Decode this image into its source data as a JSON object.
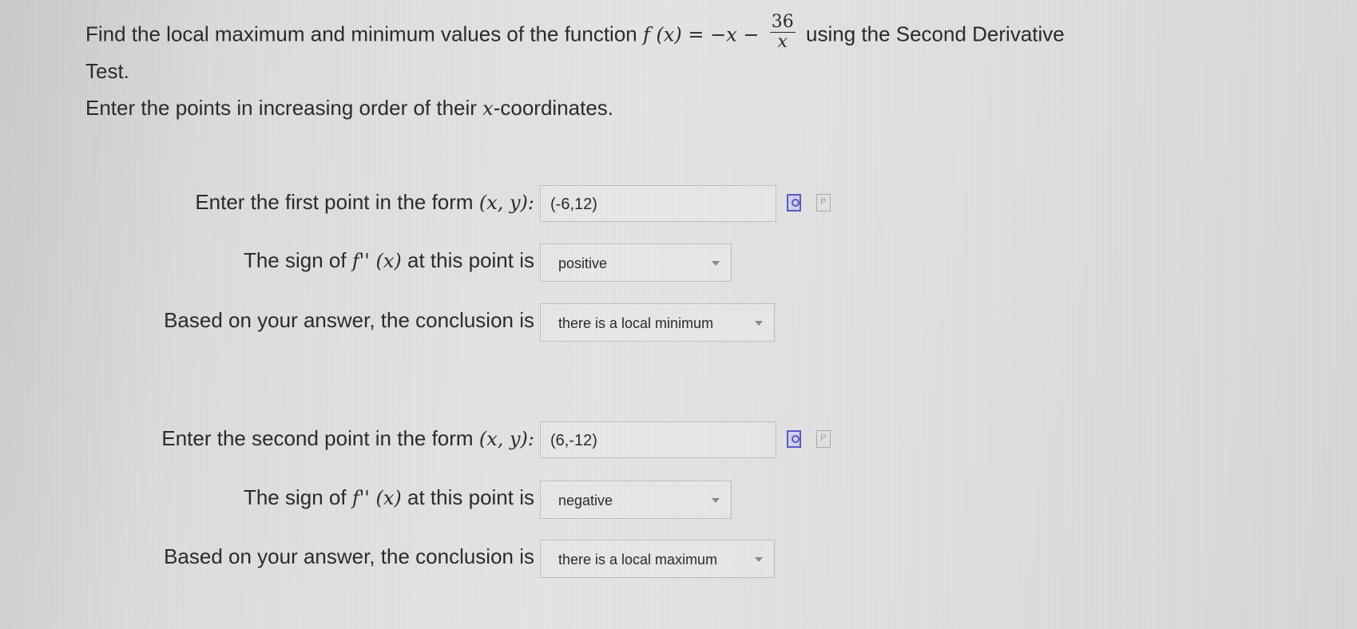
{
  "question": {
    "prefix": "Find the local maximum and minimum values of the function",
    "f_x": "f (x) = −x −",
    "frac_num": "36",
    "frac_den": "x",
    "suffix": "using the Second Derivative",
    "line2": "Test."
  },
  "instruction": {
    "pre": "Enter the points in increasing order of their",
    "var": "x",
    "post": "-coordinates."
  },
  "point1": {
    "label_text": "Enter the first point in the form",
    "form": "(x, y):",
    "value": "(-6,12)",
    "sign_label_pre": "The sign of",
    "sign_math": "f'' (x)",
    "sign_label_post": "at this point is",
    "sign_value": "positive",
    "conclusion_label": "Based on your answer, the conclusion is",
    "conclusion_value": "there is a local minimum"
  },
  "point2": {
    "label_text": "Enter the second point in the form",
    "form": "(x, y):",
    "value": "(6,-12)",
    "sign_label_pre": "The sign of",
    "sign_math": "f'' (x)",
    "sign_label_post": "at this point is",
    "sign_value": "negative",
    "conclusion_label": "Based on your answer, the conclusion is",
    "conclusion_value": "there is a local maximum"
  },
  "icons": {
    "preview_letter": "P"
  }
}
